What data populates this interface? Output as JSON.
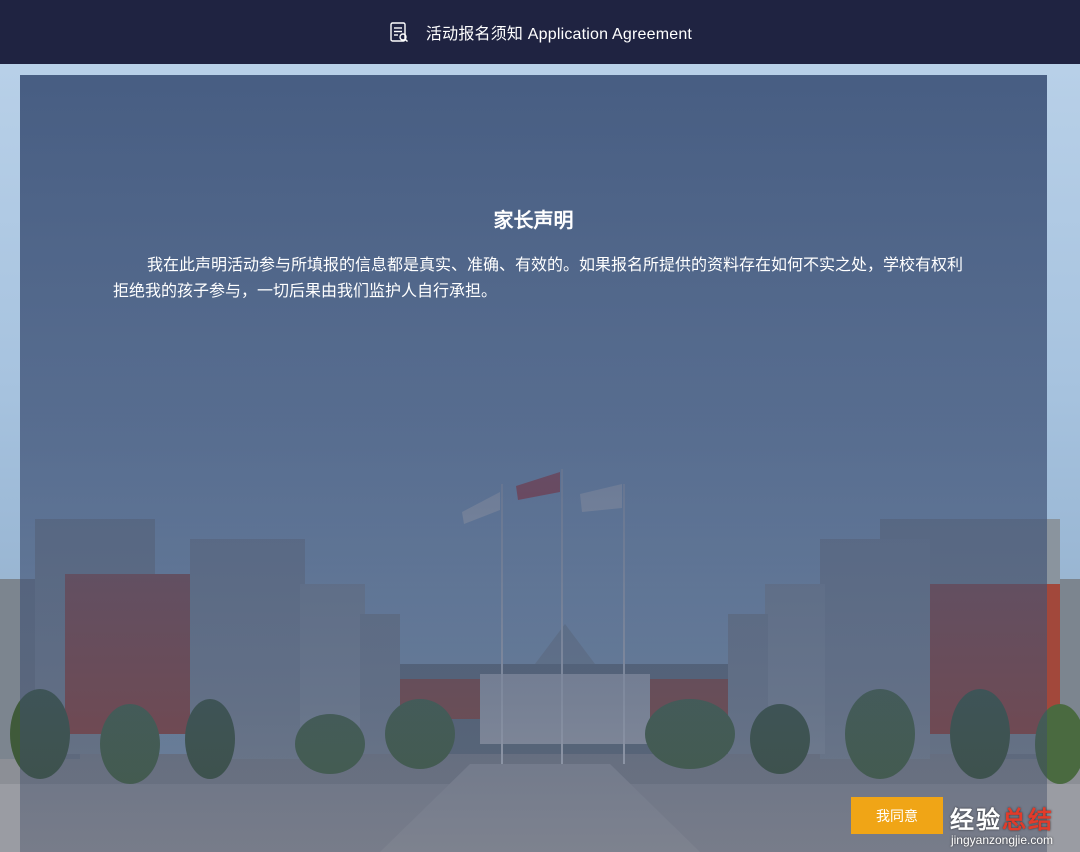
{
  "header": {
    "title": "活动报名须知 Application Agreement",
    "icon": "document-icon"
  },
  "statement": {
    "title": "家长声明",
    "body": "我在此声明活动参与所填报的信息都是真实、准确、有效的。如果报名所提供的资料存在如何不实之处，学校有权利拒绝我的孩子参与，一切后果由我们监护人自行承担。"
  },
  "actions": {
    "agree_label": "我同意"
  },
  "watermark": {
    "main_left": "经验",
    "main_right": "总结",
    "sub": "jingyanzongjie.com"
  },
  "colors": {
    "header_bg": "#1f2341",
    "agree_button": "#f0a516",
    "overlay": "#3e547a"
  }
}
